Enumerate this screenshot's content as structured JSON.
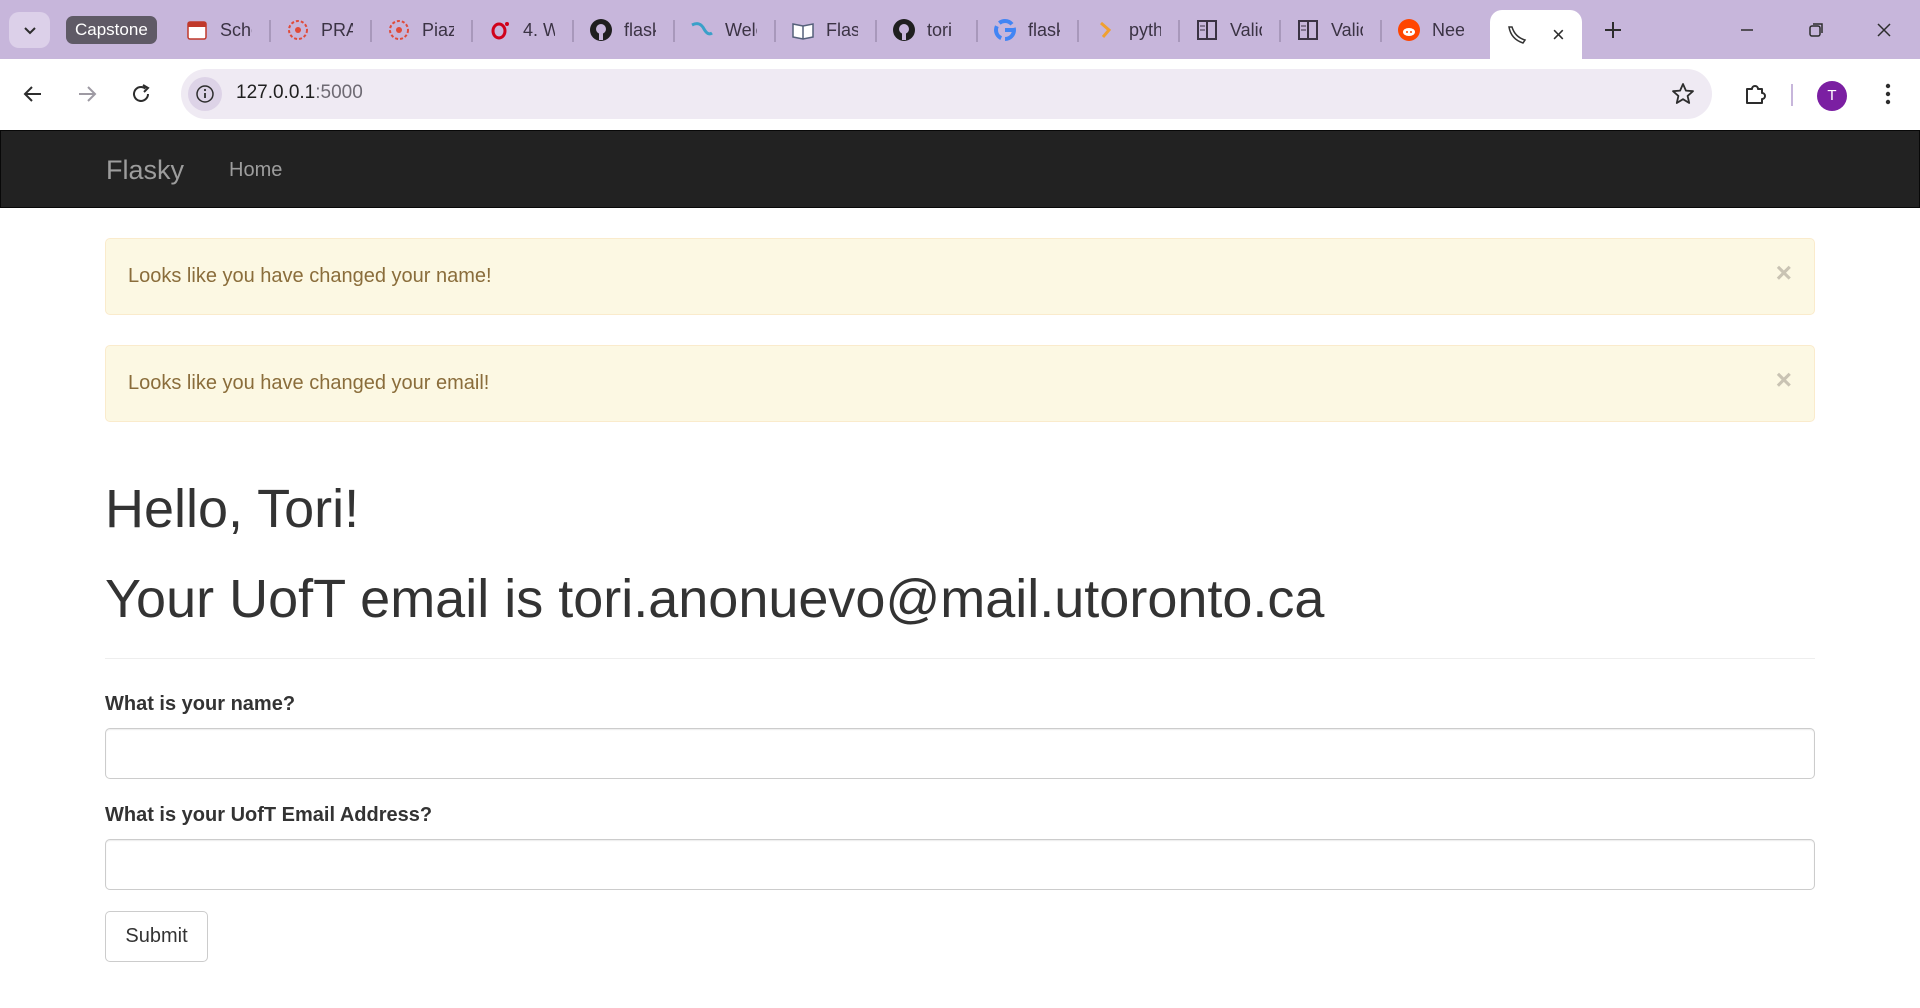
{
  "browser": {
    "tab_group_label": "Capstone",
    "tabs": [
      {
        "label": "Schedule",
        "icon": "calendar-icon"
      },
      {
        "label": "PRA",
        "icon": "quercus-icon"
      },
      {
        "label": "Piazza",
        "icon": "quercus-icon"
      },
      {
        "label": "4. W",
        "icon": "opera-icon"
      },
      {
        "label": "flask",
        "icon": "github-icon"
      },
      {
        "label": "Welcome",
        "icon": "flask-icon"
      },
      {
        "label": "Flask",
        "icon": "book-icon"
      },
      {
        "label": "tori",
        "icon": "github-icon"
      },
      {
        "label": "flask",
        "icon": "google-icon"
      },
      {
        "label": "python",
        "icon": "python-icon"
      },
      {
        "label": "Validators",
        "icon": "docs-icon"
      },
      {
        "label": "Validators",
        "icon": "docs-icon"
      },
      {
        "label": "Need",
        "icon": "reddit-icon"
      }
    ],
    "active_tab": {
      "label": "",
      "icon": "flask-horn-icon"
    },
    "url_host": "127.0.0.1",
    "url_port": ":5000",
    "profile_initial": "T",
    "accent_color": "#c7b6db",
    "avatar_color": "#7b1fa2"
  },
  "page": {
    "navbar": {
      "brand": "Flasky",
      "links": [
        {
          "label": "Home"
        }
      ]
    },
    "alerts": [
      {
        "message": "Looks like you have changed your name!",
        "close": "×"
      },
      {
        "message": "Looks like you have changed your email!",
        "close": "×"
      }
    ],
    "greeting": "Hello, Tori!",
    "email_line": "Your UofT email is tori.anonuevo@mail.utoronto.ca",
    "form": {
      "name_label": "What is your name?",
      "name_value": "",
      "email_label": "What is your UofT Email Address?",
      "email_value": "",
      "submit_label": "Submit"
    },
    "colors": {
      "navbar": "#222222",
      "alert_bg": "#fcf8e3",
      "alert_text": "#8a6d3b"
    }
  }
}
